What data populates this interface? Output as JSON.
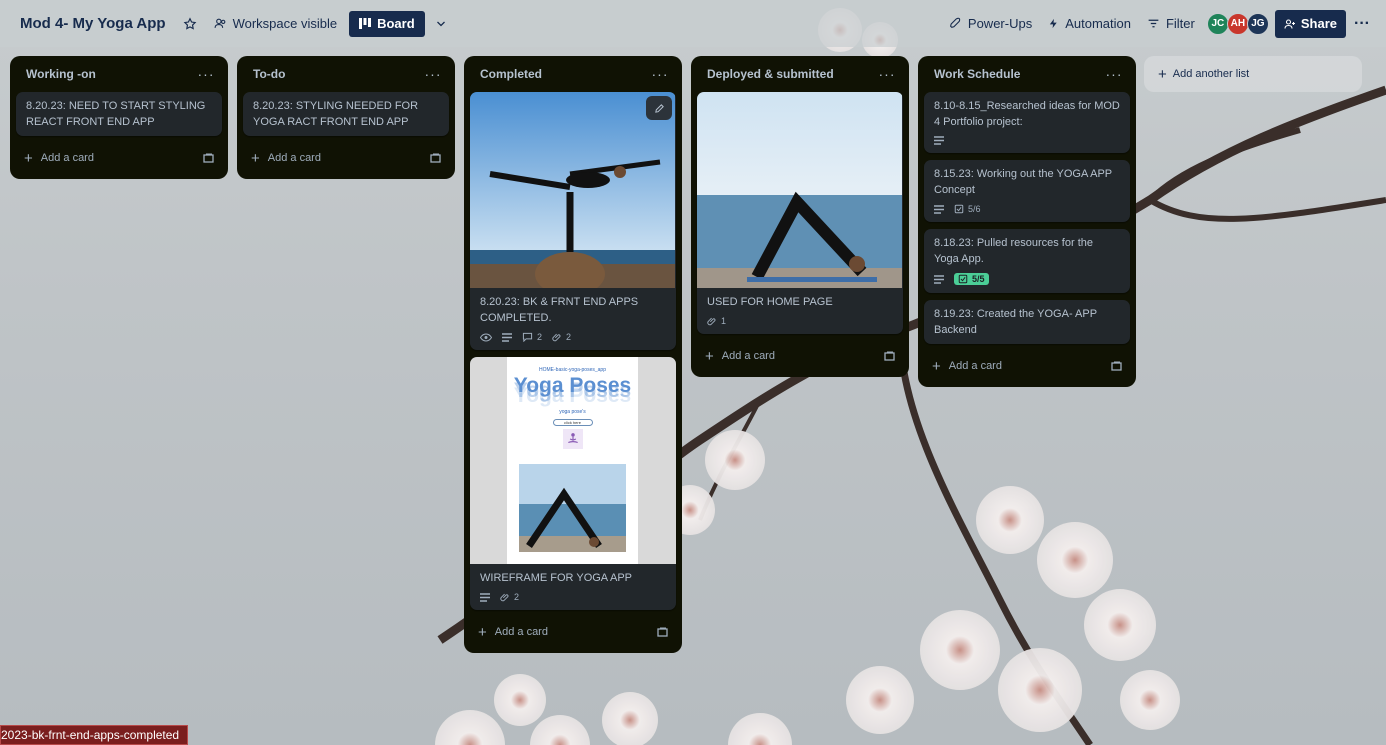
{
  "header": {
    "board_title": "Mod 4- My Yoga App",
    "visibility_label": "Workspace visible",
    "view_label": "Board",
    "powerups_label": "Power-Ups",
    "automation_label": "Automation",
    "filter_label": "Filter",
    "share_label": "Share",
    "members": [
      {
        "initials": "JC",
        "color": "#1f845a"
      },
      {
        "initials": "AH",
        "color": "#c9372c"
      },
      {
        "initials": "JG",
        "color": "#1d3557"
      }
    ]
  },
  "lists": [
    {
      "title": "Working -on",
      "cards": [
        {
          "text": "8.20.23: NEED TO START STYLING REACT FRONT END APP"
        }
      ],
      "add_label": "Add a card"
    },
    {
      "title": "To-do",
      "cards": [
        {
          "text": "8.20.23: STYLING NEEDED FOR YOGA RACT FRONT END APP"
        }
      ],
      "add_label": "Add a card"
    },
    {
      "title": "Completed",
      "cards": [
        {
          "text": "8.20.23: BK & FRNT END APPS COMPLETED.",
          "comments": "2",
          "attachments": "2"
        },
        {
          "text": "WIREFRAME FOR YOGA APP",
          "attachments": "2",
          "wireframe_title": "HOME-basic-yoga-poses_app",
          "wireframe_heading": "Yoga Poses",
          "wireframe_subheading": "yoga pose's",
          "wireframe_button": "click here"
        }
      ],
      "add_label": "Add a card"
    },
    {
      "title": "Deployed & submitted",
      "cards": [
        {
          "text": "USED FOR HOME PAGE",
          "attachments": "1"
        }
      ],
      "add_label": "Add a card"
    },
    {
      "title": "Work Schedule",
      "cards": [
        {
          "text": "8.10-8.15_Researched ideas for MOD 4 Portfolio project:"
        },
        {
          "text": "8.15.23: Working out the YOGA APP Concept",
          "checklist": "5/6"
        },
        {
          "text": "8.18.23: Pulled resources for the Yoga App.",
          "checklist": "5/5"
        },
        {
          "text": "8.19.23: Created the YOGA- APP Backend"
        }
      ],
      "add_label": "Add a card"
    }
  ],
  "add_list_label": "Add another list",
  "status_link": "2023-bk-frnt-end-apps-completed",
  "colors": {
    "list_bg": "#101204",
    "card_bg": "#22272b",
    "accent": "#172b4d",
    "complete_badge": "#4bce97"
  }
}
